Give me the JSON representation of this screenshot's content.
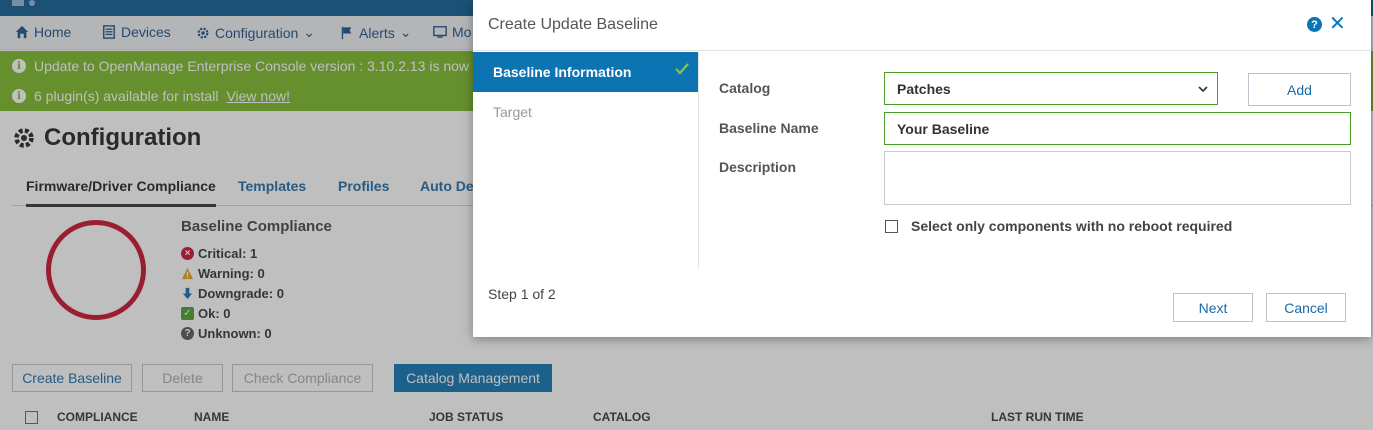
{
  "nav": {
    "home": "Home",
    "devices": "Devices",
    "configuration": "Configuration",
    "alerts": "Alerts",
    "monitor": "Mo"
  },
  "banners": {
    "update_text": "Update to OpenManage Enterprise Console version : 3.10.2.13 is now av",
    "plugins_text": "6 plugin(s) available for install",
    "plugins_link": "View now!"
  },
  "page": {
    "title": "Configuration",
    "tabs": [
      "Firmware/Driver Compliance",
      "Templates",
      "Profiles",
      "Auto Dep"
    ]
  },
  "compliance": {
    "title": "Baseline Compliance",
    "critical": "Critical: 1",
    "warning": "Warning: 0",
    "downgrade": "Downgrade: 0",
    "ok": "Ok: 0",
    "unknown": "Unknown: 0"
  },
  "actions": {
    "create_baseline": "Create Baseline",
    "delete": "Delete",
    "check_compliance": "Check Compliance",
    "catalog_management": "Catalog Management"
  },
  "table": {
    "columns": [
      "COMPLIANCE",
      "NAME",
      "JOB STATUS",
      "CATALOG",
      "LAST RUN TIME"
    ]
  },
  "modal": {
    "title": "Create Update Baseline",
    "steps": [
      {
        "label": "Baseline Information",
        "state": "active"
      },
      {
        "label": "Target",
        "state": "inactive"
      }
    ],
    "form": {
      "catalog_label": "Catalog",
      "catalog_value": "Patches",
      "add_label": "Add",
      "baseline_name_label": "Baseline Name",
      "baseline_name_value": "Your Baseline",
      "description_label": "Description",
      "description_value": "",
      "no_reboot_label": "Select only components with no reboot required",
      "no_reboot_checked": false
    },
    "step_count": "Step 1 of 2",
    "next_label": "Next",
    "cancel_label": "Cancel"
  },
  "colors": {
    "primary": "#0d74b3",
    "success": "#4b9d2a",
    "banner": "#7bb828",
    "critical": "#c8102e"
  },
  "icons": [
    "home-icon",
    "devices-icon",
    "gear-icon",
    "flag-icon",
    "monitor-icon",
    "info-icon",
    "help-icon",
    "close-icon",
    "check-icon",
    "chevron-down-icon"
  ]
}
